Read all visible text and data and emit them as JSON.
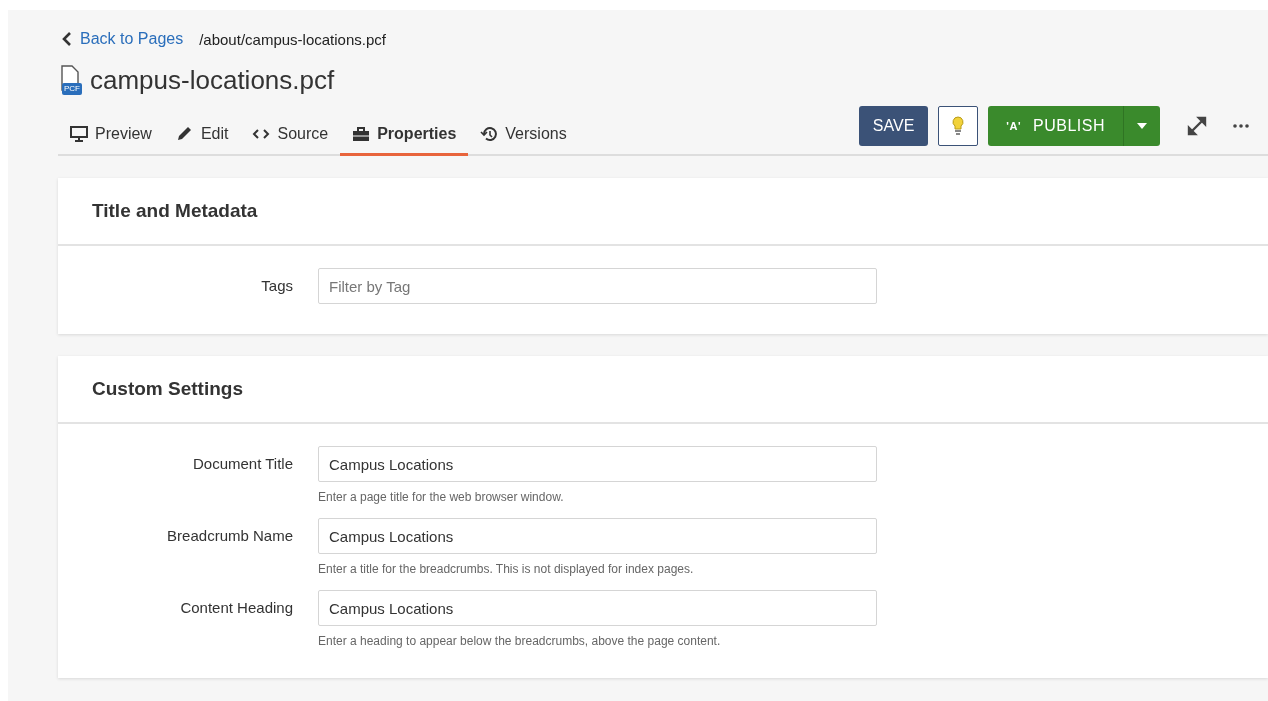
{
  "breadcrumb": {
    "back_link": "Back to Pages",
    "path": "/about/campus-locations.pcf"
  },
  "file": {
    "badge": "PCF",
    "name": "campus-locations.pcf"
  },
  "tabs": [
    {
      "kind": "preview",
      "label": "Preview",
      "selected": false
    },
    {
      "kind": "edit",
      "label": "Edit",
      "selected": false
    },
    {
      "kind": "source",
      "label": "Source",
      "selected": false
    },
    {
      "kind": "properties",
      "label": "Properties",
      "selected": true
    },
    {
      "kind": "versions",
      "label": "Versions",
      "selected": false
    }
  ],
  "toolbar": {
    "save": "SAVE",
    "publish": "PUBLISH",
    "publish_icon": "'A'"
  },
  "sections": [
    {
      "title": "Title and Metadata",
      "fields": [
        {
          "label": "Tags",
          "placeholder": "Filter by Tag"
        }
      ]
    },
    {
      "title": "Custom Settings",
      "fields": [
        {
          "label": "Document Title",
          "value": "Campus Locations",
          "help": "Enter a page title for the web browser window."
        },
        {
          "label": "Breadcrumb Name",
          "value": "Campus Locations",
          "help": "Enter a title for the breadcrumbs. This is not displayed for index pages."
        },
        {
          "label": "Content Heading",
          "value": "Campus Locations",
          "help": "Enter a heading to appear below the breadcrumbs, above the page content."
        }
      ]
    }
  ]
}
